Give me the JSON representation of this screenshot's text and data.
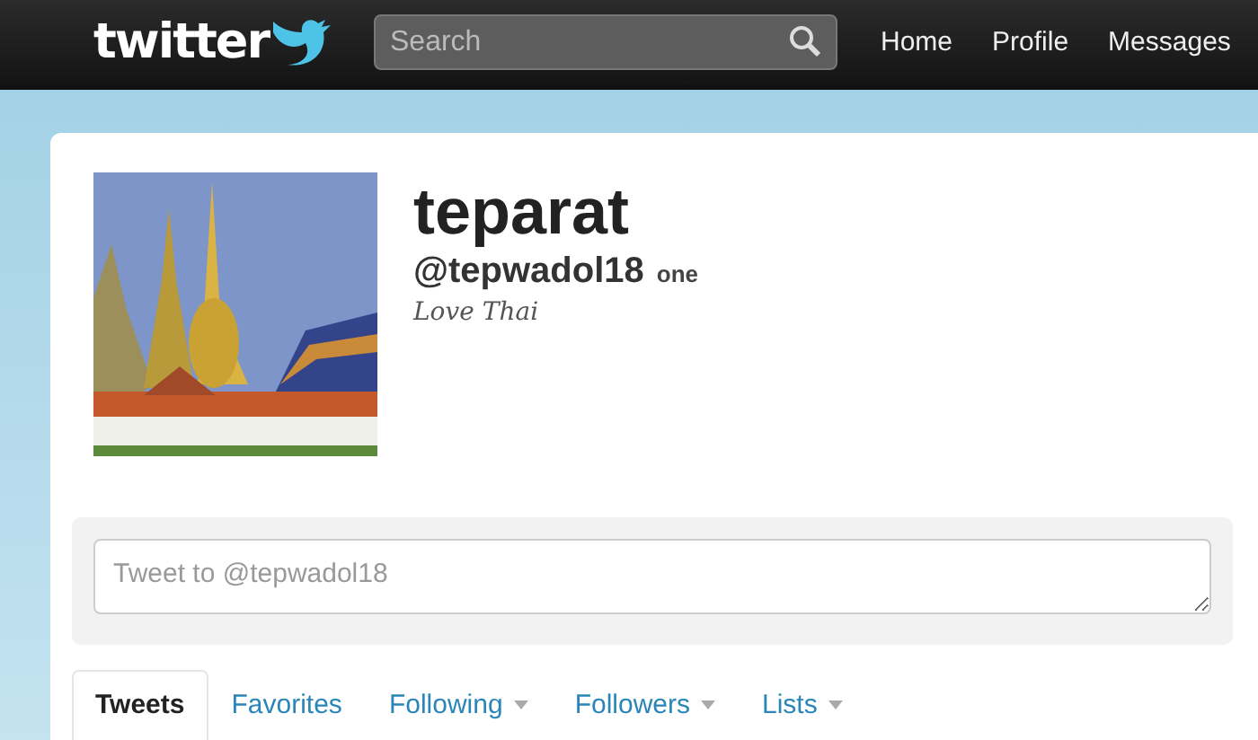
{
  "topbar": {
    "logo": "twitter",
    "search": {
      "placeholder": "Search"
    },
    "nav": [
      {
        "label": "Home"
      },
      {
        "label": "Profile"
      },
      {
        "label": "Messages"
      }
    ]
  },
  "profile": {
    "name": "teparat",
    "handle": "@tepwadol18",
    "location": "one",
    "bio": "Love Thai"
  },
  "tweet_box": {
    "placeholder": "Tweet to @tepwadol18"
  },
  "tabs": [
    {
      "label": "Tweets",
      "selected": true,
      "has_menu": false
    },
    {
      "label": "Favorites",
      "selected": false,
      "has_menu": false
    },
    {
      "label": "Following",
      "selected": false,
      "has_menu": true
    },
    {
      "label": "Followers",
      "selected": false,
      "has_menu": true
    },
    {
      "label": "Lists",
      "selected": false,
      "has_menu": true
    }
  ]
}
